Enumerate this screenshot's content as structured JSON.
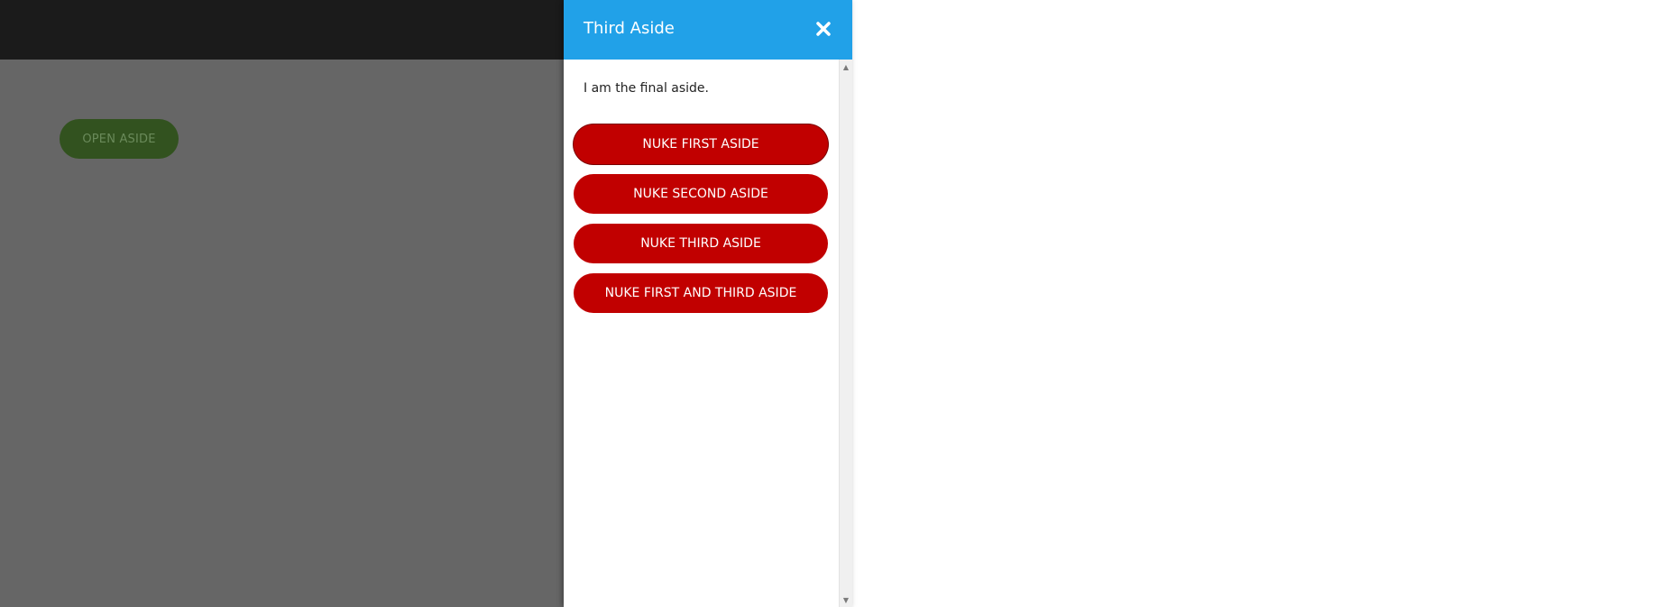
{
  "page": {
    "open_aside_label": "OPEN ASIDE"
  },
  "aside": {
    "title": "Third Aside",
    "close_icon": "close-icon",
    "body_text": "I am the final aside.",
    "buttons": [
      {
        "label": "NUKE FIRST ASIDE"
      },
      {
        "label": "NUKE SECOND ASIDE"
      },
      {
        "label": "NUKE THIRD ASIDE"
      },
      {
        "label": "NUKE FIRST AND THIRD ASIDE"
      }
    ]
  },
  "colors": {
    "header_blue": "#21a1e8",
    "nuke_red": "#c10000",
    "overlay_gray": "#666666",
    "top_bar": "#1b1b1b",
    "open_button_green": "#32521f"
  }
}
